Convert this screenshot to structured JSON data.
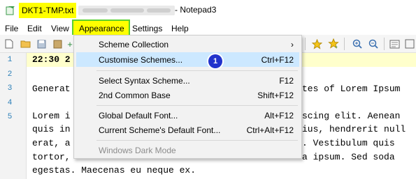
{
  "window": {
    "file_name": "DKT1-TMP.txt",
    "app_suffix": "- Notepad3"
  },
  "menubar": {
    "items": [
      "File",
      "Edit",
      "View",
      "Appearance",
      "Settings",
      "Help"
    ]
  },
  "dropdown": {
    "items": [
      {
        "label": "Scheme Collection",
        "shortcut": "›"
      },
      {
        "label": "Customise Schemes...",
        "shortcut": "Ctrl+F12",
        "badge": "1"
      },
      {
        "label": "Select Syntax Scheme...",
        "shortcut": "F12"
      },
      {
        "label": "2nd Common Base",
        "shortcut": "Shift+F12"
      },
      {
        "label": "Global Default Font...",
        "shortcut": "Alt+F12"
      },
      {
        "label": "Current Scheme's Default Font...",
        "shortcut": "Ctrl+Alt+F12"
      },
      {
        "label": "Windows Dark Mode",
        "shortcut": ""
      }
    ]
  },
  "editor": {
    "line_numbers": [
      "1",
      "2",
      "3",
      "4",
      "5"
    ],
    "line1": "22:30 2",
    "line3_left": "Generat",
    "line3_right": "tes of Lorem Ipsum",
    "line5_left": "Lorem i",
    "line5_right": "scing elit. Aenean",
    "line6_left": "quis in",
    "line6_right": "ius, hendrerit null",
    "line7_left": "erat, a",
    "line7_right": ". Vestibulum quis",
    "line8_left": "tortor,",
    "line8_right": "a ipsum. Sed soda",
    "line9": "egestas. Maecenas eu neque ex."
  },
  "colors": {
    "highlight_yellow": "#ffff00",
    "menu_hover": "#cce8ff",
    "badge_blue": "#2233cc",
    "line_number_blue": "#2b7fb8"
  }
}
